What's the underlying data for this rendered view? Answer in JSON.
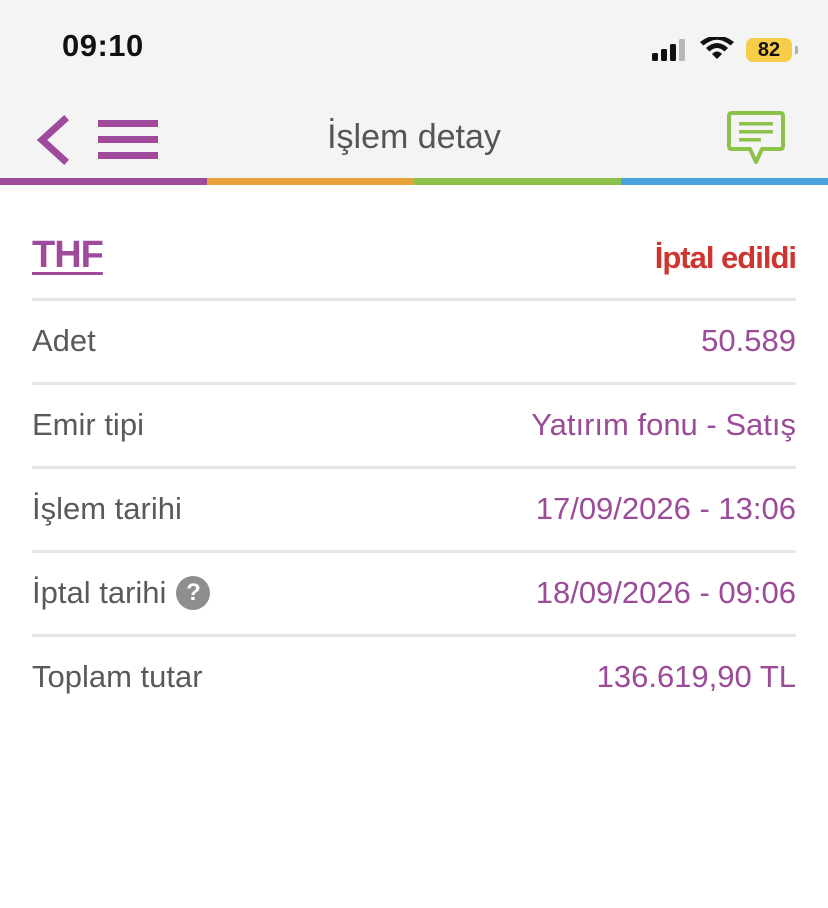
{
  "status_bar": {
    "time": "09:10",
    "battery_level": "82",
    "icons": [
      "cellular-signal-icon",
      "wifi-icon",
      "battery-icon"
    ]
  },
  "header": {
    "title": "İşlem detay",
    "icons": [
      "chevron-left-icon",
      "hamburger-menu-icon",
      "chat-bubble-icon"
    ],
    "strip_colors": [
      "#a04a9c",
      "#e8a23a",
      "#8cc14a",
      "#4ba3e0"
    ]
  },
  "transaction": {
    "fund_code": "THF",
    "status": "İptal edildi",
    "rows": [
      {
        "label": "Adet",
        "value": "50.589"
      },
      {
        "label": "Emir tipi",
        "value": "Yatırım fonu - Satış"
      },
      {
        "label": "İşlem tarihi",
        "value": "17/09/2026 - 13:06"
      },
      {
        "label": "İptal tarihi",
        "value": "18/09/2026 - 09:06",
        "help_icon": "?"
      },
      {
        "label": "Toplam tutar",
        "value": "136.619,90 TL"
      }
    ]
  },
  "colors": {
    "accent_purple": "#9b4b97",
    "status_red": "#d1332e",
    "chat_green": "#8cc14a",
    "label_gray": "#5a5a5a"
  }
}
